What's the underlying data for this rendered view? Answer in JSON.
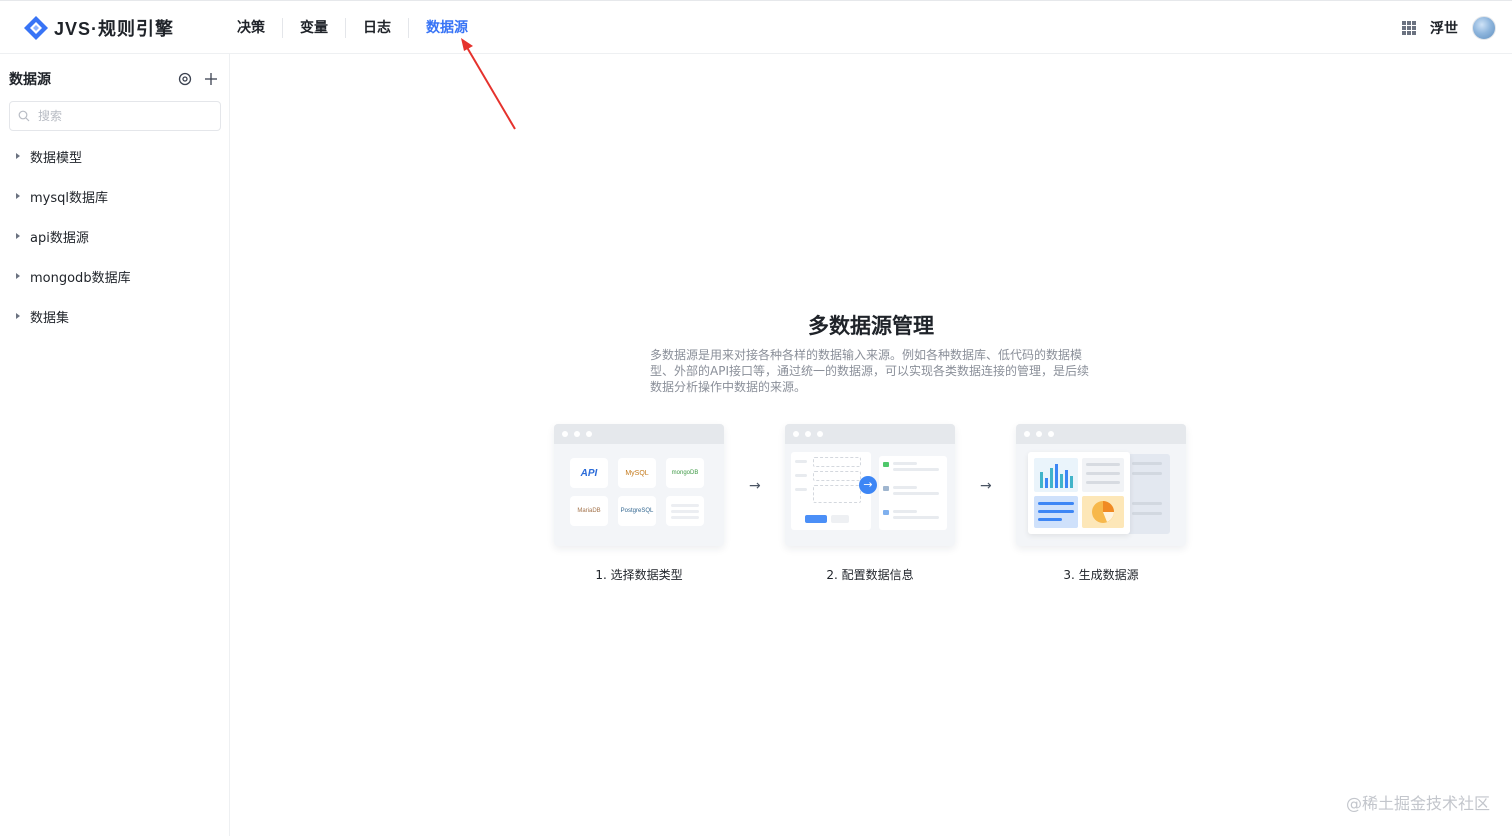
{
  "app": {
    "logo_text": "JVS·规则引擎",
    "brand_color": "#3874f6"
  },
  "nav": {
    "items": [
      {
        "label": "决策",
        "active": false
      },
      {
        "label": "变量",
        "active": false
      },
      {
        "label": "日志",
        "active": false
      },
      {
        "label": "数据源",
        "active": true
      }
    ]
  },
  "user": {
    "name": "浮世",
    "apps_icon": "apps-grid-icon"
  },
  "sidebar": {
    "title": "数据源",
    "icons": [
      "settings-icon",
      "plus-icon"
    ],
    "search_placeholder": "搜索",
    "items": [
      {
        "label": "数据模型"
      },
      {
        "label": "mysql数据库"
      },
      {
        "label": "api数据源"
      },
      {
        "label": "mongodb数据库"
      },
      {
        "label": "数据集"
      }
    ]
  },
  "main": {
    "title": "多数据源管理",
    "description": "多数据源是用来对接各种各样的数据输入来源。例如各种数据库、低代码的数据模型、外部的API接口等，通过统一的数据源，可以实现各类数据连接的管理，是后续数据分析操作中数据的来源。",
    "steps": [
      {
        "label": "1. 选择数据类型",
        "tiles": [
          "API",
          "MySQL",
          "mongoDB",
          "MariaDB",
          "PostgreSQL"
        ]
      },
      {
        "label": "2. 配置数据信息"
      },
      {
        "label": "3. 生成数据源"
      }
    ],
    "step_arrow": "→"
  },
  "watermark": "@稀土掘金技术社区"
}
